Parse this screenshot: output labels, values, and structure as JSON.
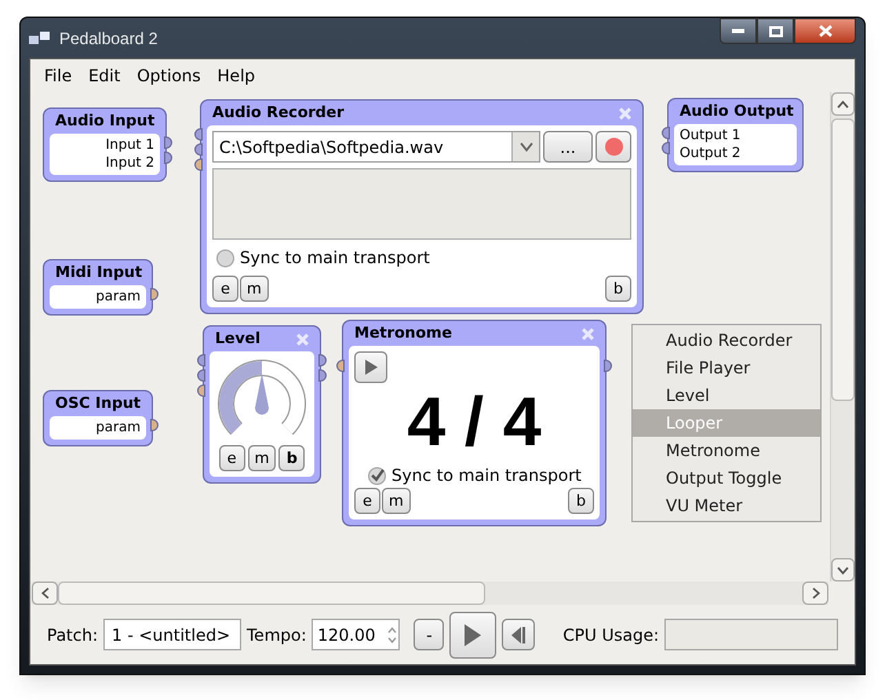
{
  "window": {
    "title": "Pedalboard 2"
  },
  "menu": [
    "File",
    "Edit",
    "Options",
    "Help"
  ],
  "nodes": [
    {
      "kind": "io",
      "title": "Audio Input",
      "labels": [
        "Input 1",
        "Input 2"
      ],
      "out_ports": [
        {
          "color": "#9c9cd8"
        },
        {
          "color": "#9c9cd8"
        }
      ]
    },
    {
      "kind": "io",
      "title": "Midi Input",
      "labels": [
        "param"
      ],
      "out_ports": [
        {
          "color": "#d8b08c"
        }
      ]
    },
    {
      "kind": "io",
      "title": "OSC Input",
      "labels": [
        "param"
      ],
      "out_ports": [
        {
          "color": "#d8b08c"
        }
      ]
    },
    {
      "kind": "recorder",
      "title": "Audio Recorder",
      "closable": true,
      "file": "C:\\Softpedia\\Softpedia.wav",
      "browse": "...",
      "sync": {
        "label": "Sync to main transport",
        "checked": false
      },
      "buttons": [
        {
          "label": "e",
          "active": false
        },
        {
          "label": "m",
          "active": false
        }
      ],
      "bypass": {
        "label": "b",
        "active": false
      },
      "in_ports": [
        {
          "color": "#9c9cd8"
        },
        {
          "color": "#9c9cd8"
        },
        {
          "color": "#d8b08c"
        }
      ]
    },
    {
      "kind": "io",
      "title": "Audio Output",
      "labels": [
        "Output 1",
        "Output 2"
      ],
      "in_ports": [
        {
          "color": "#9c9cd8"
        },
        {
          "color": "#9c9cd8"
        }
      ]
    },
    {
      "kind": "level",
      "title": "Level",
      "closable": true,
      "level": 0.5,
      "buttons": [
        {
          "label": "e",
          "active": false
        },
        {
          "label": "m",
          "active": false
        }
      ],
      "bypass": {
        "label": "b",
        "active": true
      },
      "in_ports": [
        {
          "color": "#9c9cd8"
        },
        {
          "color": "#9c9cd8"
        },
        {
          "color": "#d8b08c"
        }
      ],
      "out_ports": [
        {
          "color": "#9c9cd8"
        },
        {
          "color": "#9c9cd8"
        }
      ]
    },
    {
      "kind": "metronome",
      "title": "Metronome",
      "closable": true,
      "signature": "4 / 4",
      "sync": {
        "label": "Sync to main transport",
        "checked": true
      },
      "buttons": [
        {
          "label": "e",
          "active": false
        },
        {
          "label": "m",
          "active": false
        }
      ],
      "bypass": {
        "label": "b",
        "active": false
      },
      "in_ports": [
        {
          "color": "#d8b08c"
        }
      ],
      "out_ports": [
        {
          "color": "#9c9cd8"
        }
      ]
    }
  ],
  "popup": [
    {
      "label": "Audio Recorder",
      "selected": false
    },
    {
      "label": "File Player",
      "selected": false
    },
    {
      "label": "Level",
      "selected": false
    },
    {
      "label": "Looper",
      "selected": true
    },
    {
      "label": "Metronome",
      "selected": false
    },
    {
      "label": "Output Toggle",
      "selected": false
    },
    {
      "label": "VU Meter",
      "selected": false
    }
  ],
  "bottom": {
    "patch_label": "Patch:",
    "patch": "1 - <untitled>",
    "tempo_label": "Tempo:",
    "tempo": "120.00",
    "minus": "-",
    "cpu_label": "CPU Usage:"
  }
}
